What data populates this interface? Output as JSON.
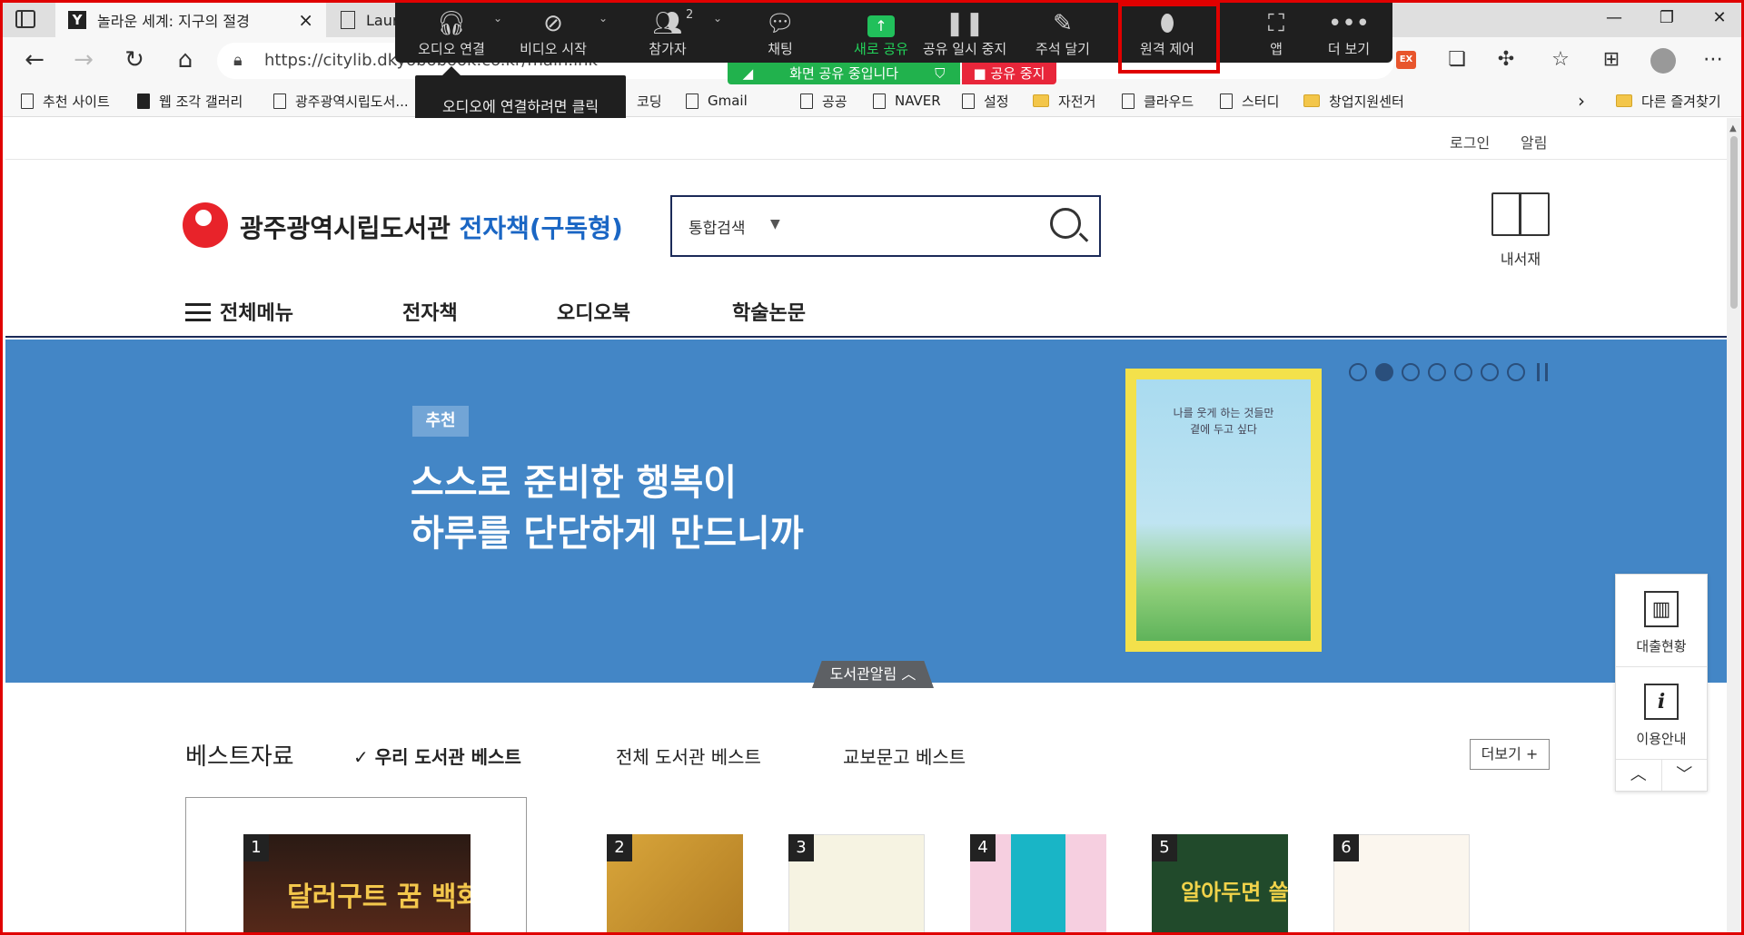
{
  "browser": {
    "tabs": [
      {
        "title": "놀라운 세계: 지구의 절경",
        "close": "×"
      },
      {
        "title": "Laur"
      }
    ],
    "url": "https://citylib.dkyobobook.co.kr/main.ink",
    "bookmarks": [
      "추천 사이트",
      "웹 조각 갤러리",
      "광주광역시립도서...",
      "코딩",
      "Gmail",
      "공공",
      "NAVER",
      "설정",
      "자전거",
      "클라우드",
      "스터디",
      "창업지원센터",
      "다른 즐겨찾기"
    ],
    "ex_badge": "EX"
  },
  "zoom": {
    "buttons": [
      {
        "label": "오디오 연결",
        "icon": "headphones-icon"
      },
      {
        "label": "비디오 시작",
        "icon": "video-off-icon"
      },
      {
        "label": "참가자",
        "icon": "participants-icon",
        "count": "2"
      },
      {
        "label": "채팅",
        "icon": "chat-icon"
      },
      {
        "label": "새로 공유",
        "icon": "share-icon"
      },
      {
        "label": "공유 일시 중지",
        "icon": "pause-icon"
      },
      {
        "label": "주석 달기",
        "icon": "pencil-icon"
      },
      {
        "label": "원격 제어",
        "icon": "mouse-icon"
      },
      {
        "label": "앱",
        "icon": "apps-icon"
      },
      {
        "label": "더 보기",
        "icon": "more-icon"
      }
    ],
    "sharing_banner": "화면 공유 중입니다",
    "stop_share": "공유 중지",
    "tooltip": "오디오에 연결하려면 클릭",
    "share_color": "#21c05b",
    "stop_color": "#e8263a"
  },
  "site": {
    "utility": {
      "login": "로그인",
      "notice": "알림"
    },
    "logo_title": "광주광역시립도서관",
    "logo_sub": "전자책(구독형)",
    "search": {
      "scope": "통합검색",
      "value": ""
    },
    "my_library": "내서재",
    "nav": {
      "all_menu": "전체메뉴",
      "items": [
        "전자책",
        "오디오북",
        "학술논문"
      ]
    },
    "hero": {
      "tag": "추천",
      "line1": "스스로 준비한 행복이",
      "line2": "하루를 단단하게 만드니까",
      "book_title": "나를 웃게 하는 것들만\n곁에 두고 싶다",
      "slide_count": 7,
      "active_slide": 2,
      "bg_color": "#4386c6"
    },
    "notice_tab": "도서관알림",
    "best": {
      "title": "베스트자료",
      "tabs": [
        "우리 도서관 베스트",
        "전체 도서관 베스트",
        "교보문고 베스트"
      ],
      "selected_tab": 0,
      "more": "더보기 +",
      "ranks": [
        "1",
        "2",
        "3",
        "4",
        "5",
        "6"
      ],
      "book1_title": "달러구트 꿈 백화점",
      "book5_title": "알아두면 쓸데있는"
    },
    "side": {
      "loan": "대출현황",
      "guide": "이용안내"
    }
  }
}
